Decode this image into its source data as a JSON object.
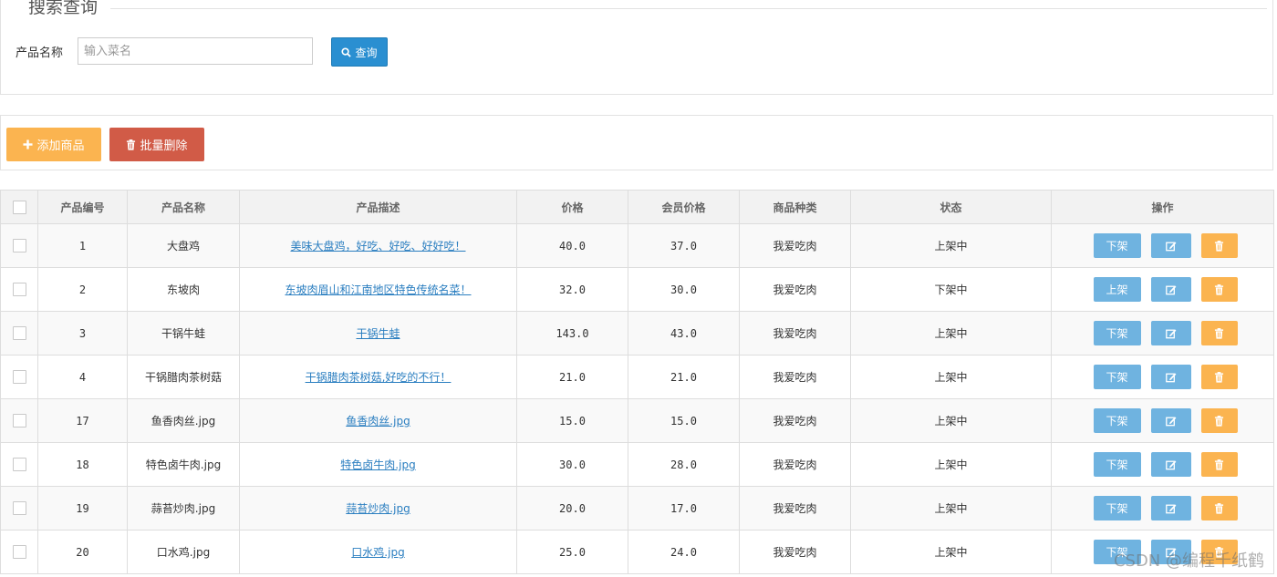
{
  "search": {
    "section_title": "搜索查询",
    "name_label": "产品名称",
    "placeholder": "输入菜名",
    "value": "",
    "button_label": "查询",
    "button_icon": "search-icon"
  },
  "actions": {
    "add_label": "添加商品",
    "add_icon": "plus-icon",
    "bulk_delete_label": "批量删除",
    "bulk_delete_icon": "trash-icon"
  },
  "table": {
    "headers": [
      "产品编号",
      "产品名称",
      "产品描述",
      "价格",
      "会员价格",
      "商品种类",
      "状态",
      "操作"
    ],
    "rows": [
      {
        "id": "1",
        "name": "大盘鸡",
        "desc": "美味大盘鸡，好吃、好吃、好好吃！",
        "price": "40.0",
        "member_price": "37.0",
        "category": "我爱吃肉",
        "status": "上架中",
        "toggle": "下架"
      },
      {
        "id": "2",
        "name": "东坡肉",
        "desc": "东坡肉眉山和江南地区特色传统名菜！",
        "price": "32.0",
        "member_price": "30.0",
        "category": "我爱吃肉",
        "status": "下架中",
        "toggle": "上架"
      },
      {
        "id": "3",
        "name": "干锅牛蛙",
        "desc": "干锅牛蛙",
        "price": "143.0",
        "member_price": "43.0",
        "category": "我爱吃肉",
        "status": "上架中",
        "toggle": "下架"
      },
      {
        "id": "4",
        "name": "干锅腊肉茶树菇",
        "desc": "干锅腊肉茶树菇,好吃的不行！",
        "price": "21.0",
        "member_price": "21.0",
        "category": "我爱吃肉",
        "status": "上架中",
        "toggle": "下架"
      },
      {
        "id": "17",
        "name": "鱼香肉丝.jpg",
        "desc": "鱼香肉丝.jpg",
        "price": "15.0",
        "member_price": "15.0",
        "category": "我爱吃肉",
        "status": "上架中",
        "toggle": "下架"
      },
      {
        "id": "18",
        "name": "特色卤牛肉.jpg",
        "desc": "特色卤牛肉.jpg",
        "price": "30.0",
        "member_price": "28.0",
        "category": "我爱吃肉",
        "status": "上架中",
        "toggle": "下架"
      },
      {
        "id": "19",
        "name": "蒜苔炒肉.jpg",
        "desc": "蒜苔炒肉.jpg",
        "price": "20.0",
        "member_price": "17.0",
        "category": "我爱吃肉",
        "status": "上架中",
        "toggle": "下架"
      },
      {
        "id": "20",
        "name": "口水鸡.jpg",
        "desc": "口水鸡.jpg",
        "price": "25.0",
        "member_price": "24.0",
        "category": "我爱吃肉",
        "status": "上架中",
        "toggle": "下架"
      }
    ],
    "row_icons": {
      "edit": "pencil-icon",
      "delete": "trash-icon"
    }
  },
  "watermark": "CSDN @编程千纸鹤",
  "colors": {
    "primary_blue": "#2a8fd1",
    "light_blue": "#6fb3e0",
    "warning_orange": "#fbb450",
    "danger_red": "#d15b47",
    "link_blue": "#2a7ec0"
  }
}
